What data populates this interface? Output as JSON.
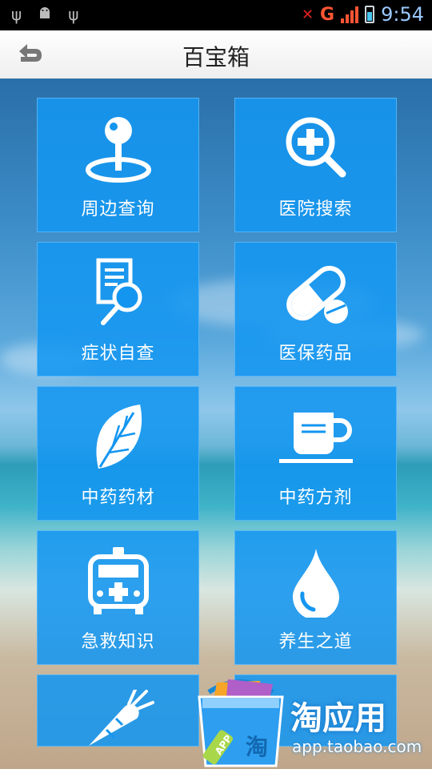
{
  "status_bar": {
    "network": "G",
    "time": "9:54",
    "missed_call_count": "1"
  },
  "header": {
    "title": "百宝箱"
  },
  "tiles": [
    {
      "label": "周边查询",
      "icon": "location-pin-icon"
    },
    {
      "label": "医院搜索",
      "icon": "hospital-search-icon"
    },
    {
      "label": "症状自查",
      "icon": "symptom-check-icon"
    },
    {
      "label": "医保药品",
      "icon": "pill-icon"
    },
    {
      "label": "中药药材",
      "icon": "leaf-icon"
    },
    {
      "label": "中药方剂",
      "icon": "teacup-icon"
    },
    {
      "label": "急救知识",
      "icon": "ambulance-icon"
    },
    {
      "label": "养生之道",
      "icon": "water-drop-icon"
    },
    {
      "label": "",
      "icon": "carrot-icon"
    }
  ],
  "promo": {
    "brand": "淘应用",
    "url": "app.taobao.com",
    "badge": "APP",
    "bag_char": "淘"
  },
  "colors": {
    "tile": "#1496f0",
    "title_bar": "#f4f4f4",
    "status_bar": "#000000"
  }
}
